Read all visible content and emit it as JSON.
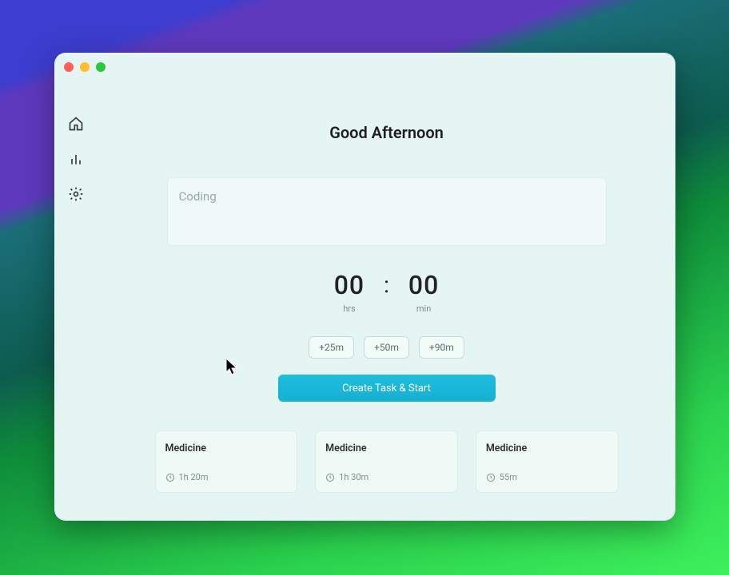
{
  "header": {
    "title": "Good Afternoon"
  },
  "sidebar": {
    "items": [
      "home",
      "analytics",
      "settings"
    ]
  },
  "task_input": {
    "placeholder": "Coding",
    "value": ""
  },
  "timer": {
    "hours": "00",
    "hours_label": "hrs",
    "minutes": "00",
    "minutes_label": "min",
    "separator": ":"
  },
  "presets": [
    "+25m",
    "+50m",
    "+90m"
  ],
  "create_button": "Create Task & Start",
  "recent_tasks": [
    {
      "title": "Medicine",
      "duration": "1h 20m"
    },
    {
      "title": "Medicine",
      "duration": "1h 30m"
    },
    {
      "title": "Medicine",
      "duration": "55m"
    }
  ],
  "visual": {
    "accent": "#1ab5d6"
  }
}
